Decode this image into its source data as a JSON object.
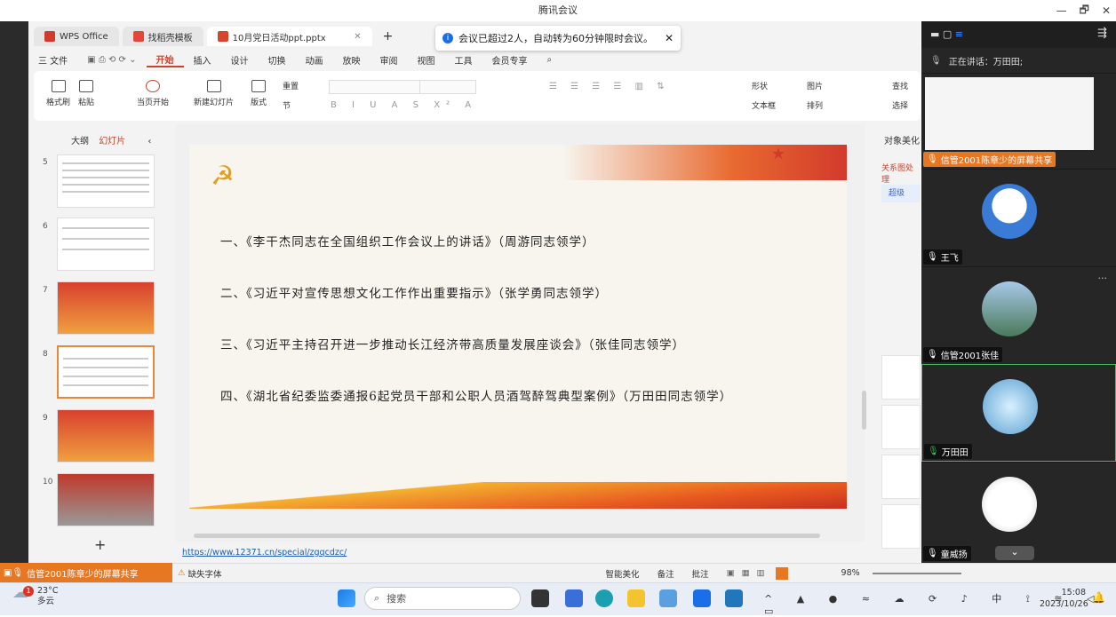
{
  "window": {
    "title": "腾讯会议",
    "controls": [
      "—",
      "🗗",
      "✕"
    ]
  },
  "wps": {
    "tabs": [
      {
        "label": "WPS Office"
      },
      {
        "label": "找稻壳模板"
      },
      {
        "label": "10月党日活动ppt.pptx",
        "active": true
      }
    ],
    "new_tab": "+",
    "menu": {
      "file": "三 文件",
      "items": [
        "开始",
        "插入",
        "设计",
        "切换",
        "动画",
        "放映",
        "审阅",
        "视图",
        "工具",
        "会员专享"
      ]
    },
    "ribbon": {
      "format_painter": "格式刷",
      "paste": "粘贴",
      "play_from_current": "当页开始",
      "new_slide": "新建幻灯片",
      "layout": "版式",
      "section": "节",
      "reset": "重置",
      "shape": "形状",
      "picture": "图片",
      "text_box": "文本框",
      "arrange": "排列",
      "find": "查找",
      "select": "选择"
    },
    "pane": {
      "outline": "大纲",
      "slides": "幻灯片",
      "add": "+"
    },
    "thumbs": [
      {
        "num": "5"
      },
      {
        "num": "6"
      },
      {
        "num": "7"
      },
      {
        "num": "8"
      },
      {
        "num": "9"
      },
      {
        "num": "10"
      }
    ],
    "slide_lines": [
      "一、《李干杰同志在全国组织工作会议上的讲话》（周游同志领学）",
      "二、《习近平对宣传思想文化工作作出重要指示》（张学勇同志领学）",
      "三、《习近平主持召开进一步推动长江经济带高质量发展座谈会》（张佳同志领学）",
      "四、《湖北省纪委监委通报6起党员干部和公职人员酒驾醉驾典型案例》（万田田同志领学）"
    ],
    "note_url": "https://www.12371.cn/special/zgqcdzc/",
    "right_pane": {
      "title": "对象美化",
      "sub": "关系图处理",
      "btn": "超级"
    },
    "status": {
      "missing_font": "缺失字体",
      "smart": "智能美化",
      "notes": "备注",
      "comment": "批注",
      "zoom": "98%"
    }
  },
  "toast": {
    "text": "会议已超过2人，自动转为60分钟限时会议。",
    "close": "✕"
  },
  "meeting": {
    "speaking_label": "正在讲话：万田田;",
    "participants": [
      {
        "name": "信管2001陈章少的屏幕共享"
      },
      {
        "name": "王飞"
      },
      {
        "name": "信管2001张佳"
      },
      {
        "name": "万田田"
      },
      {
        "name": "童威扬"
      }
    ],
    "share_badge": "信管2001陈章少的屏幕共享"
  },
  "taskbar": {
    "weather_temp": "23°C",
    "weather_desc": "多云",
    "weather_badge": "1",
    "search": "搜索",
    "time": "15:08",
    "date": "2023/10/26"
  },
  "colors": {
    "wps_red": "#c8442e",
    "share_orange": "#e87722",
    "meeting_bg": "#2b2b2b",
    "mic_green": "#3fbf5f"
  }
}
